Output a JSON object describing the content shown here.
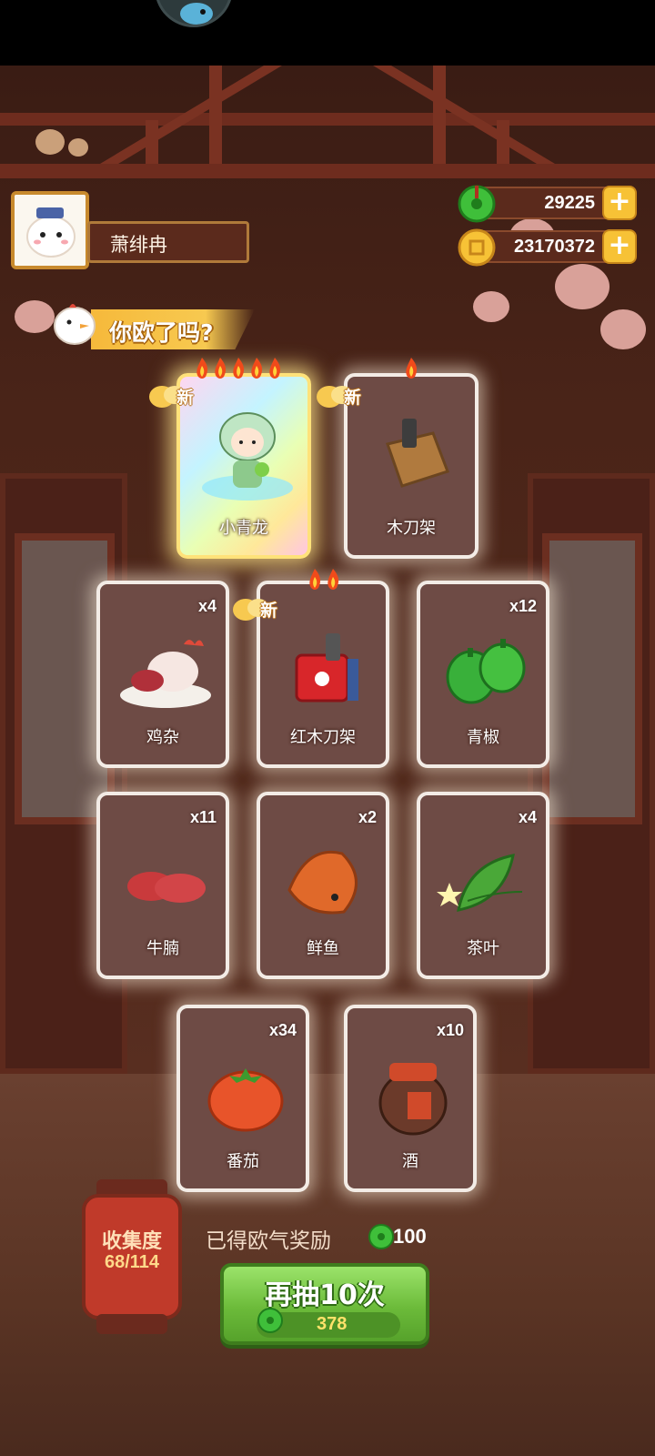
{
  "player": {
    "name": "萧绯冉"
  },
  "currencies": [
    {
      "name": "jade",
      "value": "29225",
      "color": "#3fbf3a"
    },
    {
      "name": "coin",
      "value": "23170372",
      "color": "#f7c236"
    }
  ],
  "banner": {
    "text": "你欧了吗?"
  },
  "new_label": "新",
  "cards": [
    {
      "name": "小青龙",
      "count": "",
      "rarity_flames": 5,
      "is_new": true,
      "legendary": true
    },
    {
      "name": "木刀架",
      "count": "",
      "rarity_flames": 1,
      "is_new": true,
      "legendary": false
    },
    {
      "name": "鸡杂",
      "count": "x4",
      "rarity_flames": 0,
      "is_new": false,
      "legendary": false
    },
    {
      "name": "红木刀架",
      "count": "",
      "rarity_flames": 2,
      "is_new": true,
      "legendary": false
    },
    {
      "name": "青椒",
      "count": "x12",
      "rarity_flames": 0,
      "is_new": false,
      "legendary": false
    },
    {
      "name": "牛腩",
      "count": "x11",
      "rarity_flames": 0,
      "is_new": false,
      "legendary": false
    },
    {
      "name": "鲜鱼",
      "count": "x2",
      "rarity_flames": 0,
      "is_new": false,
      "legendary": false
    },
    {
      "name": "茶叶",
      "count": "x4",
      "rarity_flames": 0,
      "is_new": false,
      "legendary": false
    },
    {
      "name": "番茄",
      "count": "x34",
      "rarity_flames": 0,
      "is_new": false,
      "legendary": false
    },
    {
      "name": "酒",
      "count": "x10",
      "rarity_flames": 0,
      "is_new": false,
      "legendary": false
    }
  ],
  "collection": {
    "label": "收集度",
    "value": "68/114"
  },
  "reward": {
    "label": "已得欧气奖励",
    "value": "100"
  },
  "draw_button": {
    "label": "再抽10次",
    "cost": "378"
  }
}
